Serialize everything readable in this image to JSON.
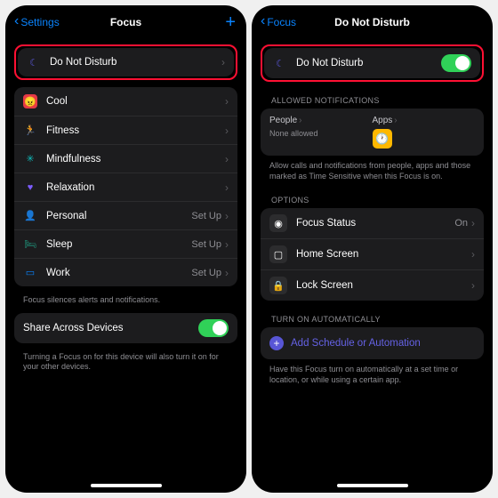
{
  "left": {
    "nav": {
      "back": "Settings",
      "title": "Focus"
    },
    "dnd": {
      "label": "Do Not Disturb"
    },
    "modes": [
      {
        "icon": "😠",
        "cls": "i-cool",
        "label": "Cool",
        "trail": ""
      },
      {
        "icon": "🏃",
        "cls": "i-fit",
        "label": "Fitness",
        "trail": ""
      },
      {
        "icon": "✳︎",
        "cls": "i-mind",
        "label": "Mindfulness",
        "trail": ""
      },
      {
        "icon": "♥︎",
        "cls": "i-relax",
        "label": "Relaxation",
        "trail": ""
      },
      {
        "icon": "👤",
        "cls": "i-pers",
        "label": "Personal",
        "trail": "Set Up"
      },
      {
        "icon": "🛏",
        "cls": "i-sleep",
        "label": "Sleep",
        "trail": "Set Up"
      },
      {
        "icon": "▭",
        "cls": "i-work",
        "label": "Work",
        "trail": "Set Up"
      }
    ],
    "foot1": "Focus silences alerts and notifications.",
    "share": {
      "label": "Share Across Devices"
    },
    "foot2": "Turning a Focus on for this device will also turn it on for your other devices."
  },
  "right": {
    "nav": {
      "back": "Focus",
      "title": "Do Not Disturb"
    },
    "dnd": {
      "label": "Do Not Disturb"
    },
    "sect_notif": "Allowed Notifications",
    "notif": {
      "people": "People",
      "people_sub": "None allowed",
      "apps": "Apps"
    },
    "notif_foot": "Allow calls and notifications from people, apps and those marked as Time Sensitive when this Focus is on.",
    "sect_opts": "Options",
    "opts": [
      {
        "icon": "◉",
        "label": "Focus Status",
        "trail": "On"
      },
      {
        "icon": "▢",
        "label": "Home Screen",
        "trail": ""
      },
      {
        "icon": "🔒",
        "label": "Lock Screen",
        "trail": ""
      }
    ],
    "sect_auto": "Turn On Automatically",
    "add": "Add Schedule or Automation",
    "auto_foot": "Have this Focus turn on automatically at a set time or location, or while using a certain app."
  }
}
